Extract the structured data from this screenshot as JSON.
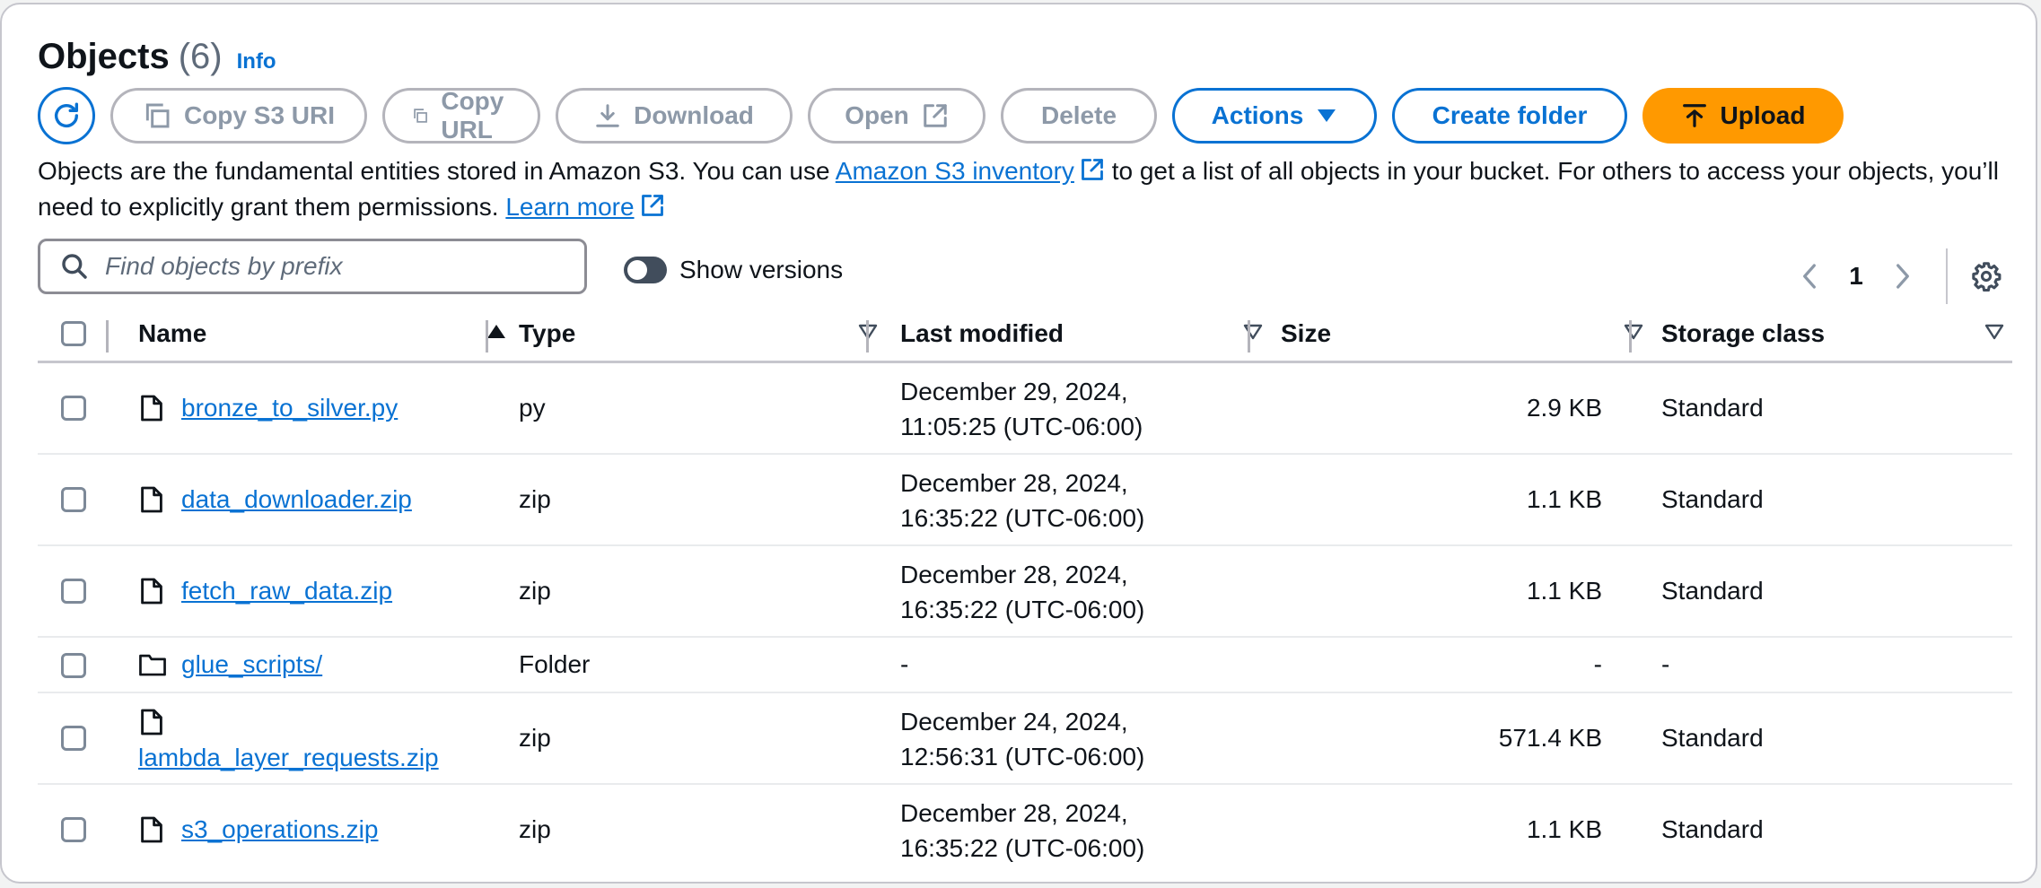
{
  "header": {
    "title": "Objects",
    "count": "(6)",
    "info": "Info"
  },
  "toolbar": {
    "copy_s3_uri": "Copy S3 URI",
    "copy_url": "Copy URL",
    "download": "Download",
    "open": "Open",
    "delete": "Delete",
    "actions": "Actions",
    "create_folder": "Create folder",
    "upload": "Upload"
  },
  "description": {
    "part1": "Objects are the fundamental entities stored in Amazon S3. You can use ",
    "inventory_link": "Amazon S3 inventory",
    "part2": " to get a list of all objects in your bucket. For others to access your objects, you’ll need to explicitly grant them permissions. ",
    "learn_more": "Learn more"
  },
  "search": {
    "placeholder": "Find objects by prefix",
    "value": ""
  },
  "versions_toggle": {
    "label": "Show versions",
    "on": false
  },
  "pagination": {
    "page": "1"
  },
  "table": {
    "columns": [
      "Name",
      "Type",
      "Last modified",
      "Size",
      "Storage class"
    ],
    "rows": [
      {
        "name": "bronze_to_silver.py",
        "icon": "file-icon",
        "type": "py",
        "modified_date": "December 29, 2024,",
        "modified_time": "11:05:25 (UTC-06:00)",
        "size": "2.9 KB",
        "storage": "Standard"
      },
      {
        "name": "data_downloader.zip",
        "icon": "file-icon",
        "type": "zip",
        "modified_date": "December 28, 2024,",
        "modified_time": "16:35:22 (UTC-06:00)",
        "size": "1.1 KB",
        "storage": "Standard"
      },
      {
        "name": "fetch_raw_data.zip",
        "icon": "file-icon",
        "type": "zip",
        "modified_date": "December 28, 2024,",
        "modified_time": "16:35:22 (UTC-06:00)",
        "size": "1.1 KB",
        "storage": "Standard"
      },
      {
        "name": "glue_scripts/",
        "icon": "folder-icon",
        "type": "Folder",
        "modified_date": "-",
        "modified_time": "",
        "size": "-",
        "storage": "-"
      },
      {
        "name": "lambda_layer_requests.zip",
        "icon": "file-icon",
        "type": "zip",
        "modified_date": "December 24, 2024,",
        "modified_time": "12:56:31 (UTC-06:00)",
        "size": "571.4 KB",
        "storage": "Standard"
      },
      {
        "name": "s3_operations.zip",
        "icon": "file-icon",
        "type": "zip",
        "modified_date": "December 28, 2024,",
        "modified_time": "16:35:22 (UTC-06:00)",
        "size": "1.1 KB",
        "storage": "Standard"
      }
    ]
  },
  "colors": {
    "link": "#0972d3",
    "upload": "#ff9900",
    "disabled": "#8d99a8",
    "border": "#c6c6cd"
  }
}
